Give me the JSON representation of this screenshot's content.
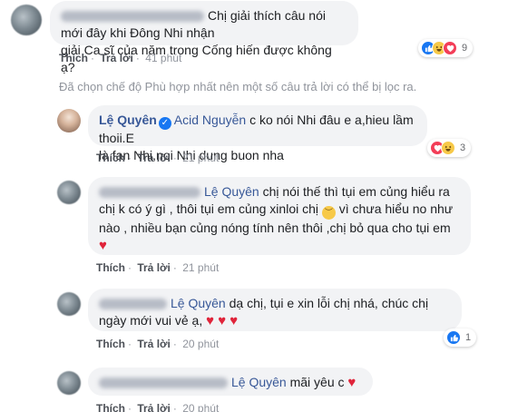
{
  "comments": [
    {
      "author_name": "",
      "text_lines": [
        "Chị giải thích câu nói mới đây khi Đông Nhi nhận",
        "giải Ca sĩ của năm trong Cống hiến được không ạ?"
      ],
      "like_label": "Thích",
      "reply_label": "Trả lời",
      "time": "41 phút",
      "reaction_count": "9",
      "reactions": [
        "like",
        "haha",
        "love"
      ]
    },
    {
      "author_name": "Lệ Quyên",
      "mention": "Acid Nguyễn",
      "text_first": " c ko nói Nhi đâu e a,hieu lầm thoii.E",
      "text_second": "là fan Nhi,noi Nhi dung buon nha",
      "like_label": "Thích",
      "reply_label": "Trả lời",
      "time": "21 phút",
      "reaction_count": "3",
      "reactions": [
        "love",
        "haha"
      ]
    },
    {
      "author_name": "",
      "mention": "Lệ Quyên",
      "text_first": " chị nói thế thì tụi em củng hiểu ra",
      "text_second": "chị k có ý gì , thôi tụi em củng xinloi chị",
      "text_second_tail": "  vì chưa hiểu no như",
      "text_third": "nào , nhiều bạn củng nóng tính nên thôi ,chị bỏ qua cho tụi em",
      "like_label": "Thích",
      "reply_label": "Trả lời",
      "time": "21 phút"
    },
    {
      "author_name": "",
      "mention": "Lệ Quyên",
      "text_first": " dạ chị, tụi e xin lỗi chị nhá, chúc chị",
      "text_second": "ngày mới vui vẻ ạ,",
      "like_label": "Thích",
      "reply_label": "Trả lời",
      "time": "20 phút",
      "reaction_count": "1",
      "reactions": [
        "like"
      ]
    },
    {
      "author_name": "",
      "mention": "Lệ Quyên",
      "text_first": " mãi yêu c",
      "like_label": "Thích",
      "reply_label": "Trả lời",
      "time": "20 phút"
    }
  ],
  "filter_note": "Đã chọn chế độ Phù hợp nhất nên một số câu trả lời có thể bị lọc ra.",
  "icons": {
    "verified": "verified-badge-icon",
    "heart": "red-heart-emoji",
    "sad": "pensive-face-emoji",
    "like": "like-reaction-icon",
    "haha": "haha-reaction-icon",
    "love": "love-reaction-icon"
  },
  "colors": {
    "link": "#385898",
    "bubble": "#f2f3f5",
    "meta": "#90949c",
    "like": "#1877f2",
    "love": "#f33e58",
    "haha": "#f7c948"
  }
}
